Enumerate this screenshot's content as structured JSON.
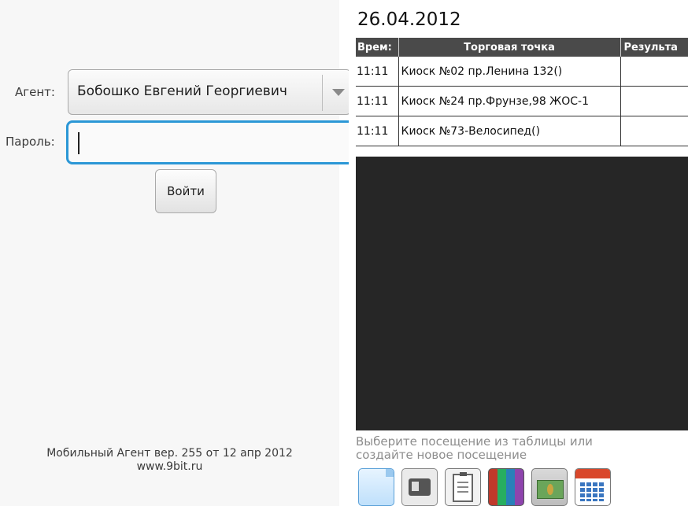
{
  "login": {
    "agent_label": "Агент:",
    "agent_value": "Бобошко Евгений Георгиевич",
    "password_label": "Пароль:",
    "password_value": "",
    "login_button": "Войти",
    "version_text": "Мобильный Агент вер. 255 от 12 апр 2012",
    "site_text": "www.9bit.ru"
  },
  "visits": {
    "date": "26.04.2012",
    "columns": [
      "Врем:",
      "Торговая точка",
      "Результа"
    ],
    "rows": [
      {
        "time": "11:11",
        "point": "Киоск №02 пр.Ленина 132()",
        "result": ""
      },
      {
        "time": "11:11",
        "point": "Киоск №24 пр.Фрунзе,98 ЖОС-1",
        "result": ""
      },
      {
        "time": "11:11",
        "point": "Киоск №73-Велосипед()",
        "result": ""
      }
    ],
    "hint_line1": "Выберите посещение из таблицы или",
    "hint_line2": "создайте новое посещение",
    "toolbar_icons": [
      "new-document-icon",
      "contact-card-icon",
      "clipboard-icon",
      "books-icon",
      "money-icon",
      "calendar-icon"
    ]
  }
}
